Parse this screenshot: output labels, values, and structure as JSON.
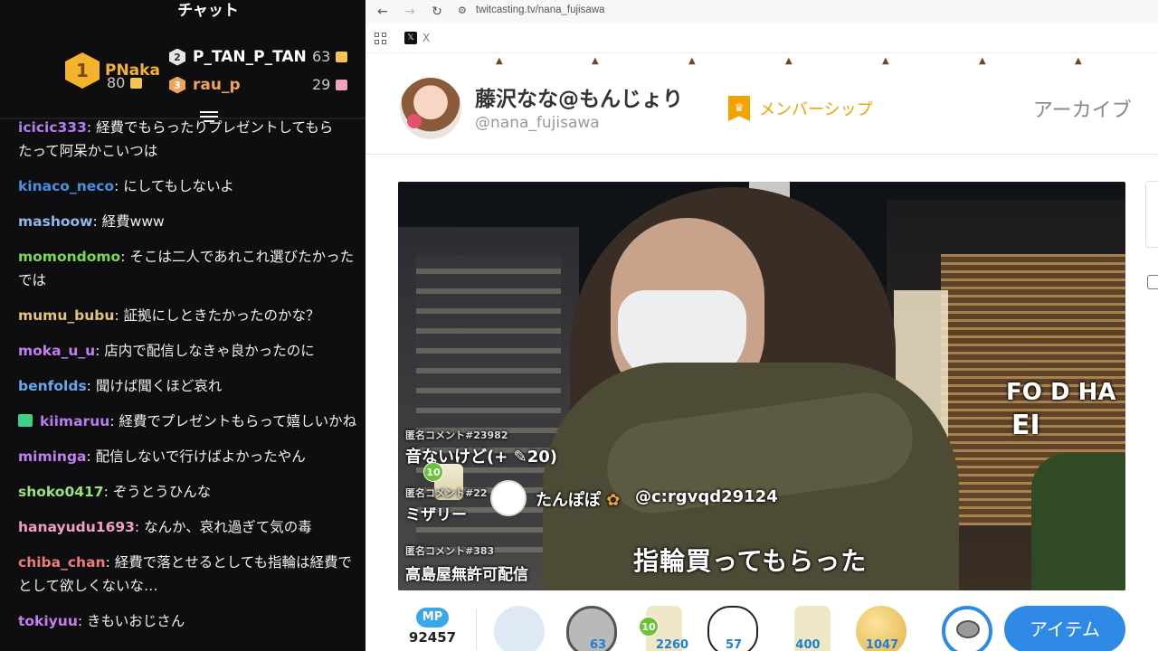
{
  "chat": {
    "title": "チャット",
    "leaderboard": [
      {
        "rank": "1",
        "name": "PNaka",
        "points": "80",
        "color": "#f3b42c"
      },
      {
        "rank": "2",
        "name": "P_TAN_P_TAN",
        "points": "63",
        "color": "#ffffff"
      },
      {
        "rank": "3",
        "name": "rau_p",
        "points": "29",
        "color": "#f0a35a"
      }
    ],
    "messages": [
      {
        "user": "icicic333",
        "text": ": 経費でもらったりプレゼントしてもら",
        "cont": "たって阿呆かこいつは",
        "color": "#b57cf0"
      },
      {
        "user": "kinaco_neco",
        "text": ": にしてもしないよ",
        "color": "#4a90e2"
      },
      {
        "user": "mashoow",
        "text": ": 経費www",
        "color": "#8fb8ea"
      },
      {
        "user": "momondomo",
        "text": ": そこは二人であれこれ選びたかった",
        "cont": "では",
        "color": "#7bd94f"
      },
      {
        "user": "mumu_bubu",
        "text": ": 証拠にしときたかったのかな？",
        "color": "#e6c27a"
      },
      {
        "user": "moka_u_u",
        "text": ": 店内で配信しなきゃ良かったのに",
        "color": "#c47ef0"
      },
      {
        "user": "benfolds",
        "text": ": 聞けば聞くほど哀れ",
        "color": "#6aa7ee"
      },
      {
        "user": "kiimaruu",
        "text": ": 経費でプレゼントもらって嬉しいかね",
        "color": "#b57cf0",
        "gift": true
      },
      {
        "user": "miminga",
        "text": ": 配信しないで行けばよかったやん",
        "color": "#c47ef0"
      },
      {
        "user": "shoko0417",
        "text": ": ぞうとうひんな",
        "color": "#9be07a"
      },
      {
        "user": "hanayudu1693",
        "text": ": なんか、哀れ過ぎて気の毒",
        "color": "#f0a0c8"
      },
      {
        "user": "chiba_chan",
        "text": ": 経費で落とせるとしても指輪は経費で",
        "cont": "として欲しくないな…",
        "color": "#f07a7a"
      },
      {
        "user": "tokiyuu",
        "text": ": きもいおじさん",
        "color": "#c47ef0"
      }
    ]
  },
  "browser": {
    "url": "twitcasting.tv/nana_fujisawa",
    "bookmark_label": "X",
    "profile": {
      "name": "藤沢なな@もんじょり",
      "handle": "@nana_fujisawa",
      "membership": "メンバーシップ",
      "archive": "アーカイブ"
    },
    "video": {
      "comment1_label": "匿名コメント#23982",
      "comment1_text": "音ないけど(+",
      "comment1_amount": "20)",
      "badge_level": "10",
      "comment2_label": "匿名コメント#22",
      "comment2_text": "ミザリー",
      "gift_user": "たんぽぽ",
      "gift_handle": "@c:rgvqd29124",
      "comment3_label": "匿名コメント#383",
      "comment3_text": "高島屋無許可配信",
      "subtitle": "指輪買ってもらった",
      "sign_text_1": "FO",
      "sign_text_2": "D HA",
      "sign_text_3": "EI"
    },
    "items": {
      "mp_label": "MP",
      "mp_value": "92457",
      "counts": [
        "63",
        "2260",
        "57",
        "400",
        "1047"
      ],
      "lv": "10",
      "button": "アイテム"
    }
  }
}
